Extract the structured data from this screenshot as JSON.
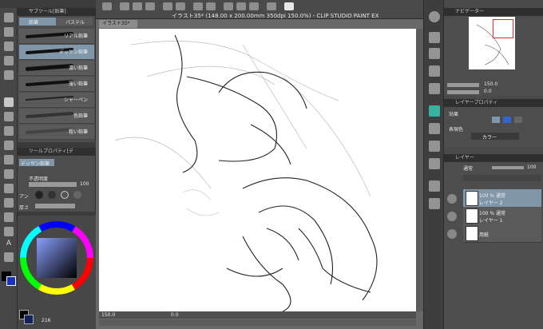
{
  "window": {
    "title": "イラスト35* (148.00 x 200.00mm 350dpi 150.0%) - CLIP STUDIO PAINT EX",
    "tab_label": "イラスト35*"
  },
  "subtool_panel": {
    "title": "サブツール[鉛筆]",
    "tabs": [
      "鉛筆",
      "パステル"
    ],
    "brushes": [
      {
        "label": "リアル鉛筆",
        "active": false
      },
      {
        "label": "デッサン鉛筆",
        "active": true
      },
      {
        "label": "濃い鉛筆",
        "active": false
      },
      {
        "label": "薄い鉛筆",
        "active": false
      },
      {
        "label": "シャーペン",
        "active": false
      },
      {
        "label": "色鉛筆",
        "active": false
      },
      {
        "label": "粗い鉛筆",
        "active": false
      }
    ]
  },
  "tool_property": {
    "title": "ツールプロパティ[デ",
    "tool_name": "デッサン鉛筆",
    "opacity_label": "不透明度",
    "opacity_value": "100",
    "antialias_label": "アン",
    "thickness_label": "厚さ"
  },
  "color_panel": {
    "main_color": "#13235c",
    "sub_color": "#000000",
    "coord_value": "216"
  },
  "navigator": {
    "title": "ナビゲーター",
    "zoom": "150.0",
    "rotation": "0.0"
  },
  "layer_property": {
    "title": "レイヤープロパティ",
    "effect_label": "効果",
    "expression_label": "表現色",
    "color_mode": "カラー"
  },
  "layers_panel": {
    "title": "レイヤー",
    "blend": "通常",
    "opacity": "100",
    "layers": [
      {
        "line1": "100 % 通常",
        "line2": "レイヤー 2",
        "selected": true
      },
      {
        "line1": "100 % 通常",
        "line2": "レイヤー 1",
        "selected": false
      },
      {
        "line1": "用紙",
        "line2": "",
        "selected": false
      }
    ]
  },
  "status": {
    "zoom": "150.0",
    "coord": "0.0"
  },
  "colors": {
    "accent": "#7f97a8",
    "nav_frame": "#e02b2b",
    "panel": "#4d4d4d"
  }
}
